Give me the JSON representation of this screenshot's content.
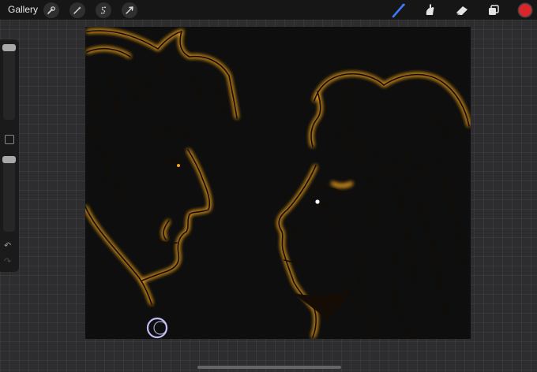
{
  "app": {
    "gallery_label": "Gallery"
  },
  "toolbar": {
    "left_tools": [
      "wrench-icon",
      "magic-wand-icon",
      "selection-s-icon",
      "transform-arrow-icon"
    ],
    "right_tools": [
      "brush-icon",
      "smudge-icon",
      "eraser-icon",
      "layers-icon"
    ],
    "active_tool": "brush-icon",
    "current_color": "#d8262b",
    "brush_accent": "#3a7bff"
  },
  "sidebar": {
    "brush_size_level": 0.05,
    "opacity_level": 0.05,
    "undo_icon": "undo-icon",
    "redo_icon": "redo-icon"
  },
  "artwork": {
    "line_color": "#1a0f05",
    "glow_color": "#f5a623",
    "signature_mark": "crescent-moon-signature"
  }
}
